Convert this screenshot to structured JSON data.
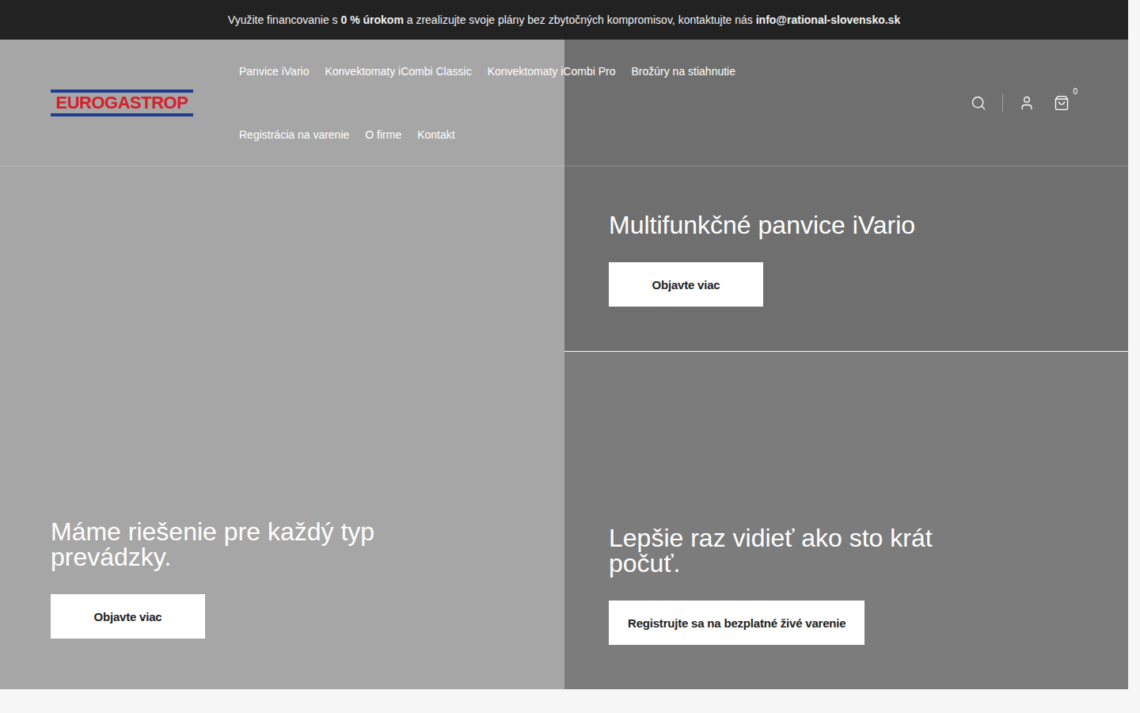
{
  "announcement": {
    "segments": [
      {
        "text": "Využite financovanie s ",
        "bold": false
      },
      {
        "text": "0 % úrokom",
        "bold": true
      },
      {
        "text": " a zrealizujte svoje plány bez zbytočných kompromisov, kontaktujte nás ",
        "bold": false
      },
      {
        "text": "info@rational-slovensko.sk",
        "bold": true
      }
    ]
  },
  "logo": {
    "text": "EUROGASTROP"
  },
  "nav": {
    "items": [
      "Panvice iVario",
      "Konvektomaty iCombi Classic",
      "Konvektomaty iCombi Pro",
      "Brožúry na stiahnutie",
      "Registrácia na varenie",
      "O firme",
      "Kontakt"
    ]
  },
  "cart": {
    "count": "0"
  },
  "hero": {
    "main": {
      "title": "Máme riešenie pre každý typ prevádzky.",
      "button": "Objavte viac"
    },
    "side": [
      {
        "title": "Multifunkčné panvice iVario",
        "button": "Objavte viac"
      },
      {
        "title": "Lepšie raz vidieť ako sto krát počuť.",
        "button": "Registrujte sa na bezplatné živé varenie"
      }
    ]
  }
}
